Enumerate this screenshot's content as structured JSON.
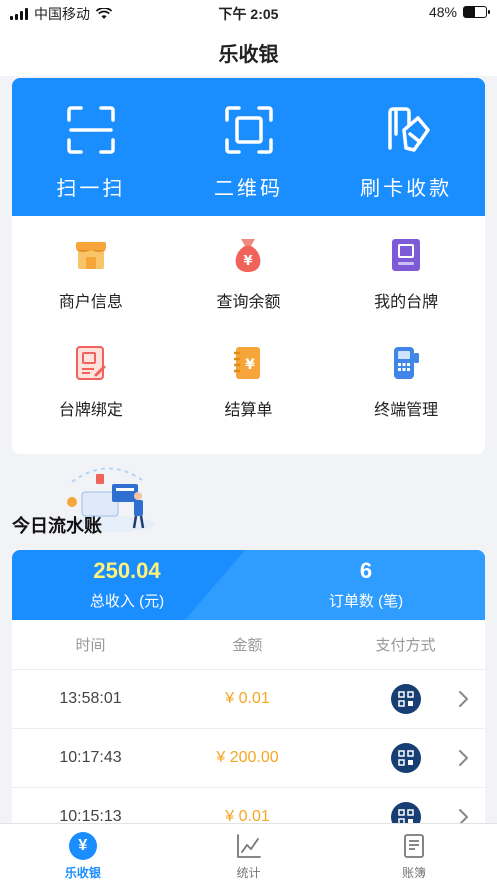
{
  "status_bar": {
    "carrier": "中国移动",
    "time": "下午 2:05",
    "battery": "48%",
    "battery_level": 0.48
  },
  "nav": {
    "title": "乐收银"
  },
  "actions": [
    {
      "label": "扫一扫",
      "icon": "scan-icon"
    },
    {
      "label": "二维码",
      "icon": "qrcode-frame-icon"
    },
    {
      "label": "刷卡收款",
      "icon": "card-swipe-icon"
    }
  ],
  "menu": [
    {
      "label": "商户信息",
      "icon": "store-icon",
      "color": "#f5a53a"
    },
    {
      "label": "查询余额",
      "icon": "money-bag-icon",
      "color": "#f0625a"
    },
    {
      "label": "我的台牌",
      "icon": "table-card-icon",
      "color": "#7d5bd6"
    },
    {
      "label": "台牌绑定",
      "icon": "bind-card-icon",
      "color": "#f0625a"
    },
    {
      "label": "结算单",
      "icon": "settlement-icon",
      "color": "#f5a53a"
    },
    {
      "label": "终端管理",
      "icon": "pos-terminal-icon",
      "color": "#3f86e8"
    }
  ],
  "ledger": {
    "title": "今日流水账",
    "total_income": "250.04",
    "total_income_label": "总收入 (元)",
    "order_count": "6",
    "order_count_label": "订单数 (笔)",
    "columns": [
      "时间",
      "金额",
      "支付方式"
    ],
    "rows": [
      {
        "time": "13:58:01",
        "amount": "¥ 0.01"
      },
      {
        "time": "10:17:43",
        "amount": "¥ 200.00"
      },
      {
        "time": "10:15:13",
        "amount": "¥ 0.01"
      }
    ]
  },
  "tabbar": [
    {
      "label": "乐收银",
      "icon": "yuan-coin-icon",
      "active": true
    },
    {
      "label": "统计",
      "icon": "line-chart-icon",
      "active": false
    },
    {
      "label": "账簿",
      "icon": "book-icon",
      "active": false
    }
  ],
  "colors": {
    "primary": "#1a8dff",
    "amount": "#f5a623",
    "pay_badge": "#173f74"
  }
}
